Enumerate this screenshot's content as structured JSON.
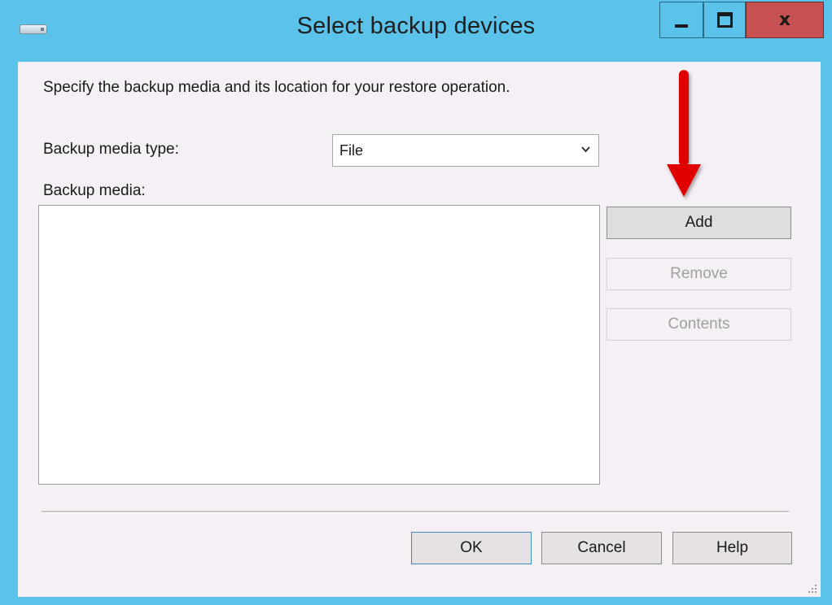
{
  "window": {
    "title": "Select backup devices",
    "title_bar_color": "#5bc3ea",
    "close_color": "#c75150",
    "controls": [
      "minimize-icon",
      "maximize-icon",
      "close-icon"
    ],
    "close_glyph": "x"
  },
  "dialog": {
    "instruction": "Specify the backup media and its location for your restore operation.",
    "media_type_label": "Backup media type:",
    "media_type_value": "File",
    "media_label": "Backup media:",
    "media_items": []
  },
  "side_buttons": {
    "add": "Add",
    "remove": "Remove",
    "contents": "Contents"
  },
  "footer_buttons": {
    "ok": "OK",
    "cancel": "Cancel",
    "help": "Help"
  },
  "annotation": {
    "icon": "red-arrow-icon",
    "color": "#e00000",
    "points_to": "Add"
  }
}
